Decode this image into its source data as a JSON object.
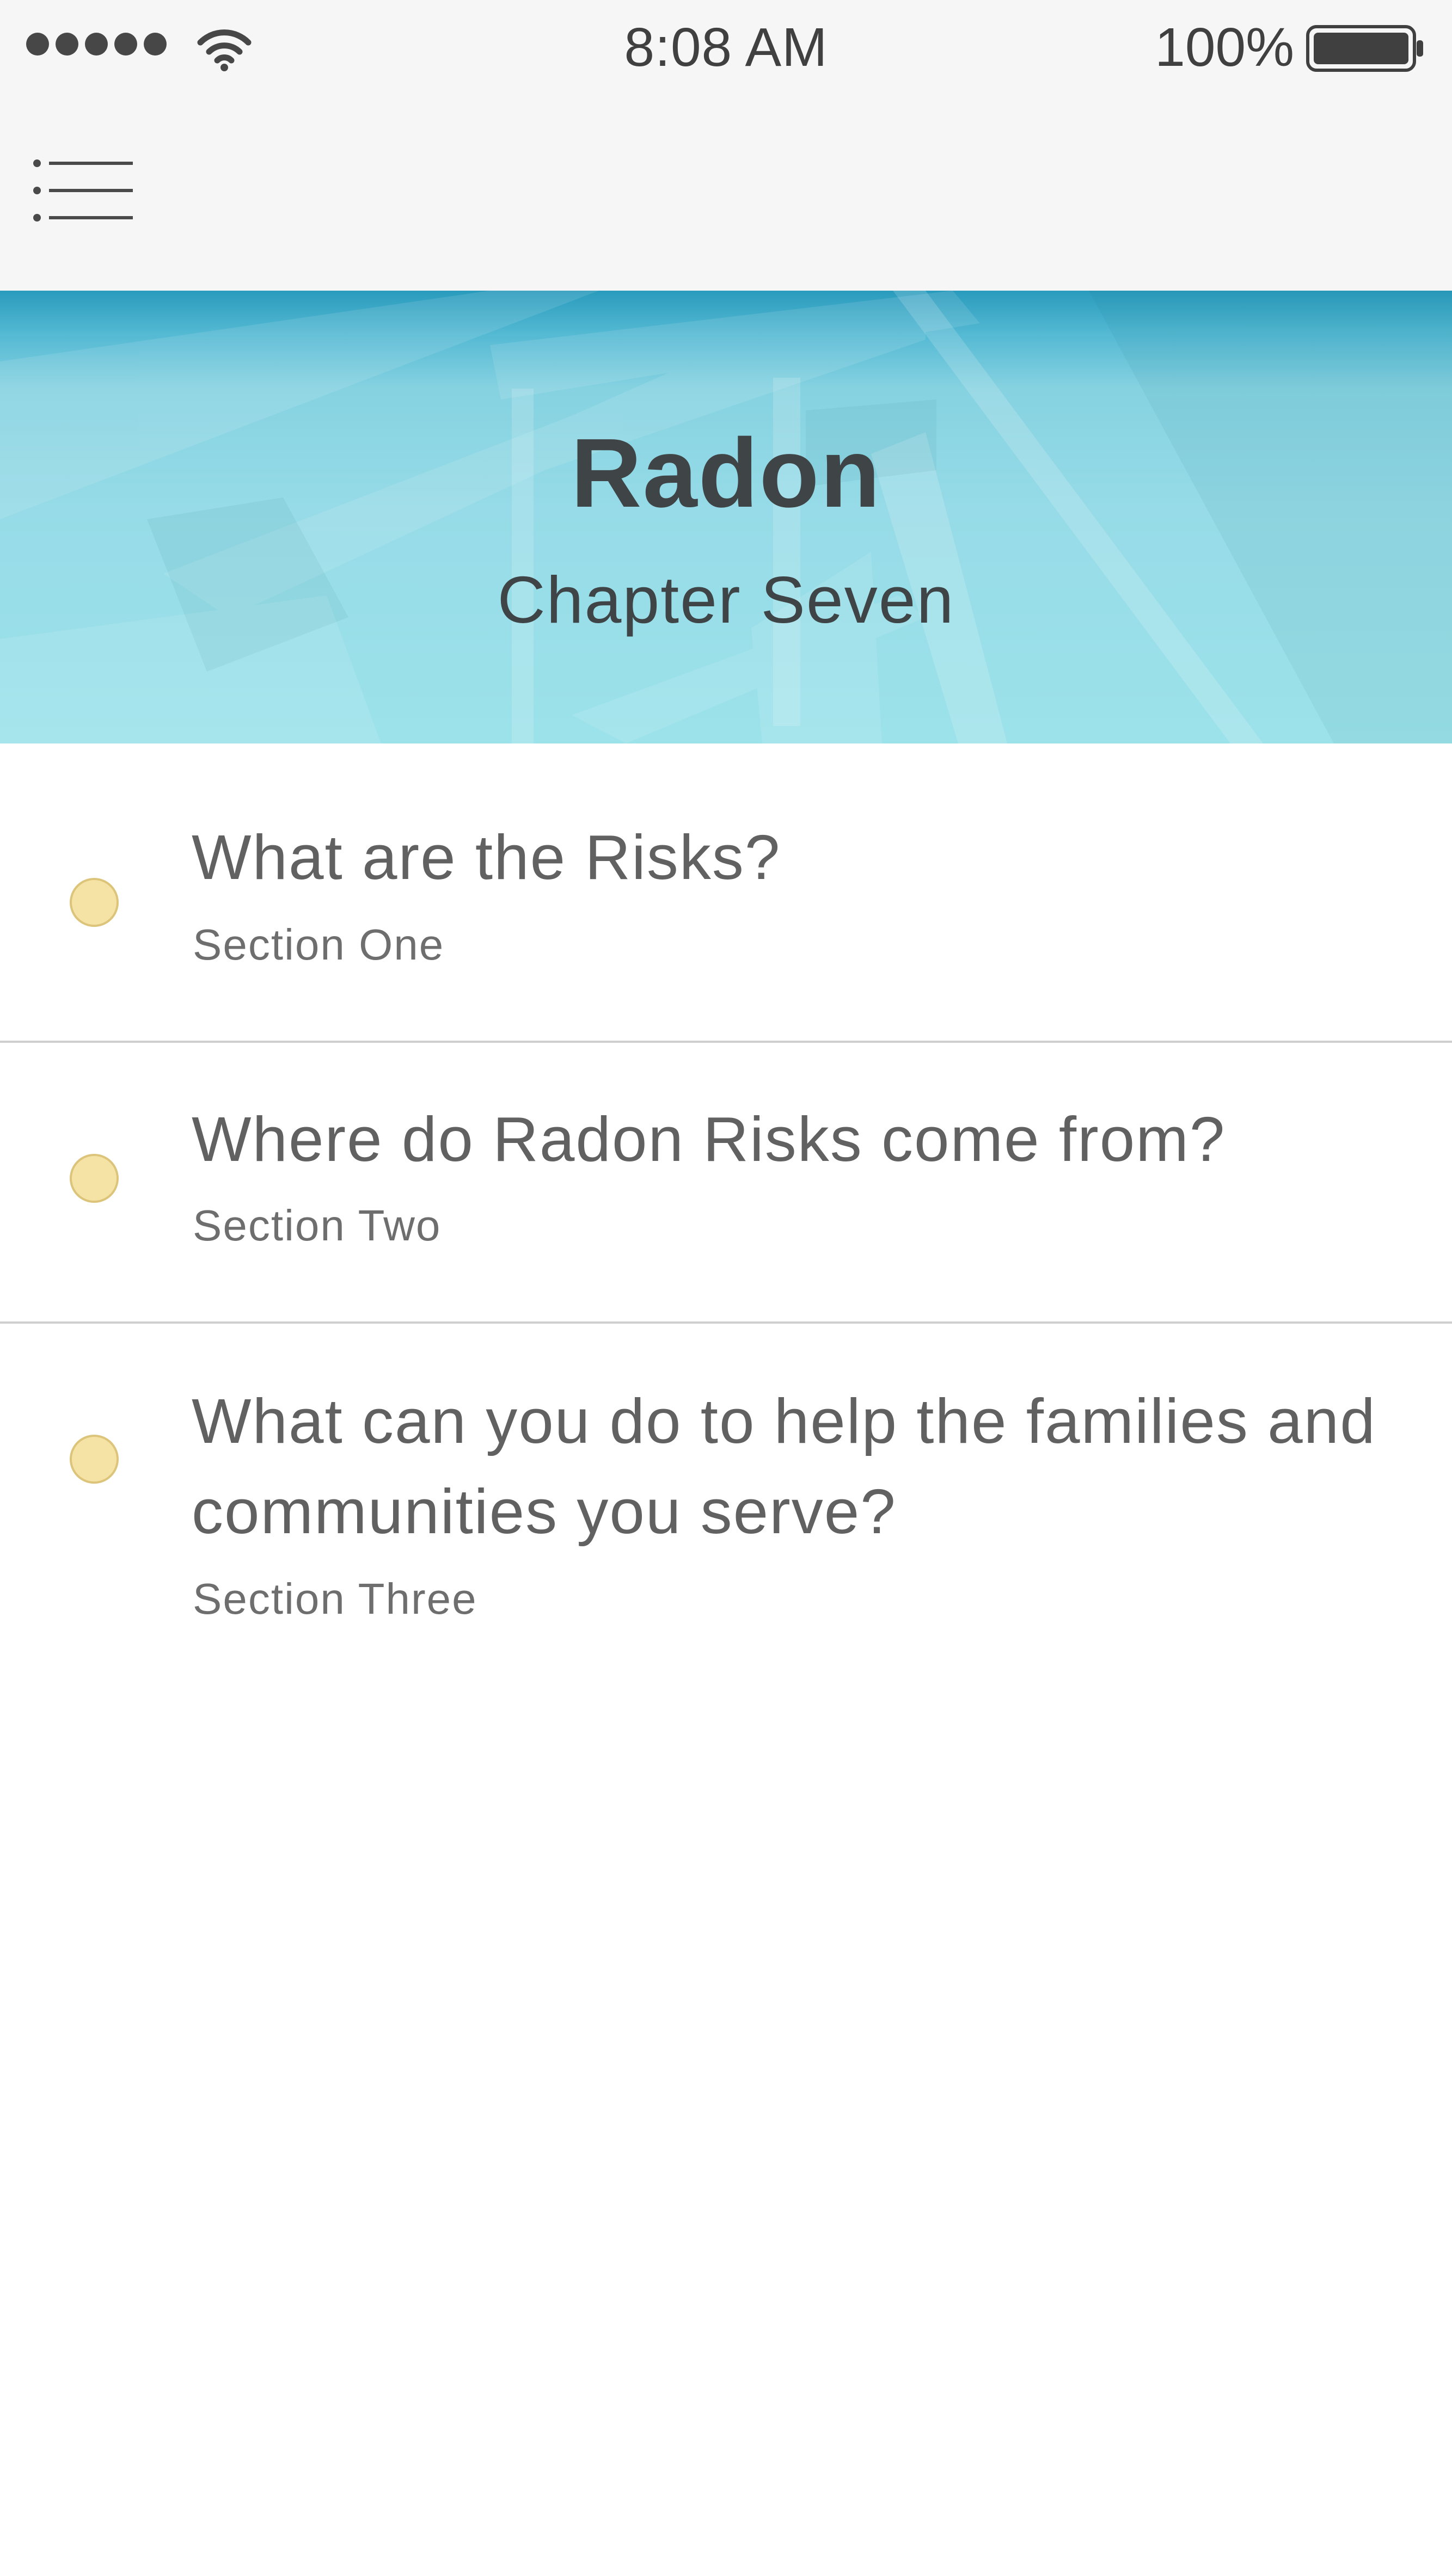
{
  "status_bar": {
    "signal_bars": 5,
    "time": "8:08 AM",
    "battery_percent": "100%",
    "battery_level": 1.0,
    "icons": [
      "signal-dots-icon",
      "wifi-icon",
      "battery-icon"
    ]
  },
  "nav": {
    "menu_icon": "hamburger-menu-icon"
  },
  "hero": {
    "title": "Radon",
    "subtitle": "Chapter Seven",
    "colors": {
      "top": "#2a9bbd",
      "bottom": "#9ce2ea"
    }
  },
  "sections": [
    {
      "title": "What are the Risks?",
      "label": "Section One"
    },
    {
      "title": "Where do Radon Risks come from?",
      "label": "Section Two"
    },
    {
      "title": "What can you do to help the families and communities you serve?",
      "label": "Section Three"
    }
  ],
  "colors": {
    "marker_fill": "#f5e3a5",
    "marker_border": "#dcc47a",
    "text": "#616161",
    "divider": "#cfcfcf"
  }
}
